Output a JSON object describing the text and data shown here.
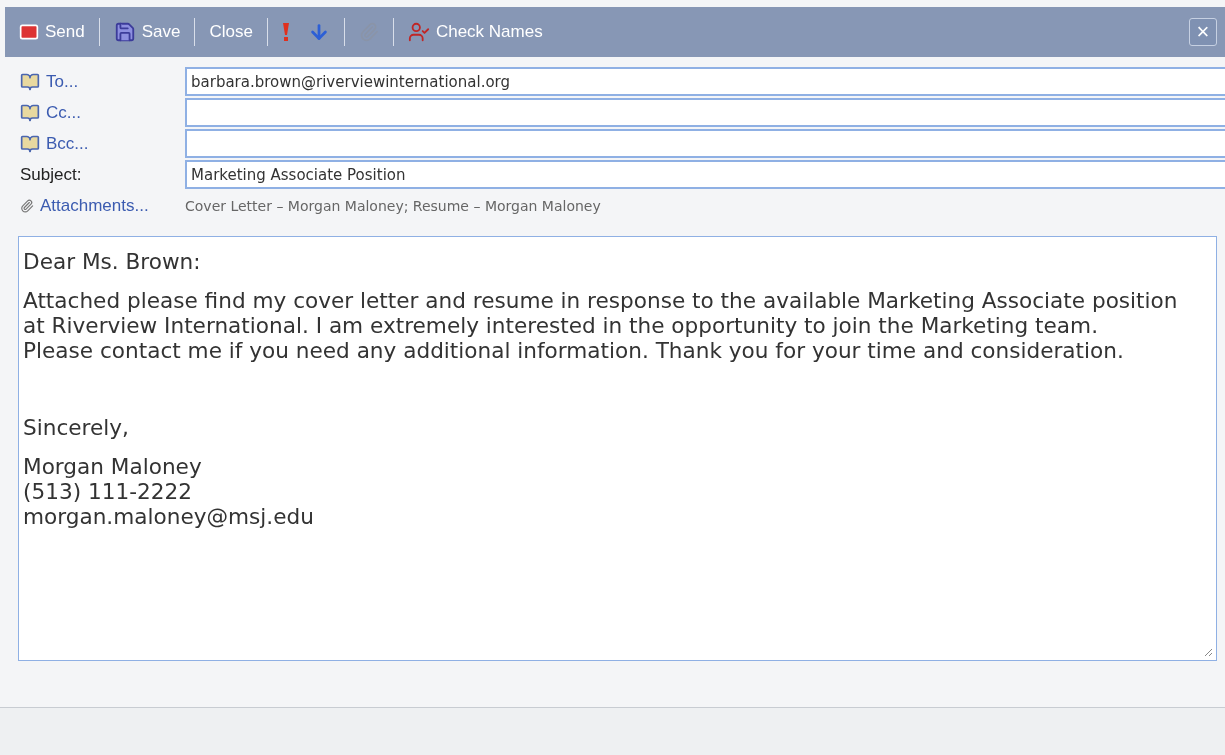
{
  "toolbar": {
    "items": [
      {
        "kind": "button",
        "label": "Send"
      },
      {
        "kind": "separator"
      },
      {
        "kind": "button",
        "label": "Save"
      },
      {
        "kind": "separator"
      },
      {
        "kind": "button",
        "label": "Close"
      },
      {
        "kind": "separator"
      },
      {
        "kind": "button"
      },
      {
        "kind": "button"
      },
      {
        "kind": "separator"
      },
      {
        "kind": "button"
      },
      {
        "kind": "separator"
      },
      {
        "kind": "button",
        "label": "Check Names"
      }
    ],
    "close": "×"
  },
  "fields": [
    {
      "kind": "address",
      "label": "To...",
      "value": "barbara.brown@riverviewinternational.org"
    },
    {
      "kind": "address",
      "label": "Cc..."
    },
    {
      "kind": "address",
      "label": "Bcc..."
    },
    {
      "kind": "plain",
      "label": "Subject:",
      "value": "Marketing Associate Position"
    }
  ],
  "attachments": {
    "label": "Attachments...",
    "value": "Cover Letter – Morgan Maloney; Resume – Morgan Maloney"
  },
  "body": [
    [
      "Dear Ms. Brown:"
    ],
    [
      "Attached please find my cover letter and resume in response to the available Marketing Associate position",
      "at Riverview International. I am extremely interested in the opportunity to join the Marketing team.",
      "Please contact me if you need any additional information. Thank you for your time and consideration."
    ],
    [
      "Sincerely,"
    ],
    [
      "Morgan Maloney",
      "(513) 111-2222",
      "morgan.maloney@msj.edu"
    ]
  ]
}
